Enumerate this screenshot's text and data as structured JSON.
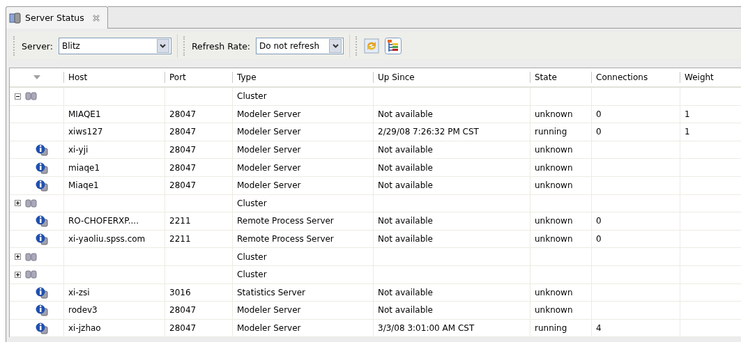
{
  "tab": {
    "title": "Server Status"
  },
  "toolbar": {
    "server_label": "Server:",
    "server_value": "Blitz",
    "refresh_label": "Refresh Rate:",
    "refresh_value": "Do not refresh"
  },
  "table": {
    "columns": [
      "Host",
      "Port",
      "Type",
      "Up Since",
      "State",
      "Connections",
      "Weight"
    ],
    "rows": [
      {
        "kind": "cluster",
        "expanded": true,
        "cells": [
          "",
          "",
          "Cluster",
          "",
          "",
          "",
          ""
        ],
        "children": [
          {
            "kind": "server",
            "info": false,
            "cells": [
              "MIAQE1",
              "28047",
              "Modeler Server",
              "Not available",
              "unknown",
              "0",
              "1"
            ]
          },
          {
            "kind": "server",
            "info": false,
            "cells": [
              "xiws127",
              "28047",
              "Modeler Server",
              "2/29/08 7:26:32 PM CST",
              "running",
              "0",
              "1"
            ]
          },
          {
            "kind": "server",
            "info": true,
            "cells": [
              "xi-yji",
              "28047",
              "Modeler Server",
              "Not available",
              "unknown",
              "",
              ""
            ]
          },
          {
            "kind": "server",
            "info": true,
            "cells": [
              "miaqe1",
              "28047",
              "Modeler Server",
              "Not available",
              "unknown",
              "",
              ""
            ]
          },
          {
            "kind": "server",
            "info": true,
            "cells": [
              "Miaqe1",
              "28047",
              "Modeler Server",
              "Not available",
              "unknown",
              "",
              ""
            ]
          }
        ]
      },
      {
        "kind": "cluster",
        "expanded": false,
        "cells": [
          "",
          "",
          "Cluster",
          "",
          "",
          "",
          ""
        ]
      },
      {
        "kind": "server",
        "info": true,
        "cells": [
          "RO-CHOFERXP....",
          "2211",
          "Remote Process Server",
          "Not available",
          "unknown",
          "0",
          ""
        ]
      },
      {
        "kind": "server",
        "info": true,
        "cells": [
          "xi-yaoliu.spss.com",
          "2211",
          "Remote Process Server",
          "Not available",
          "unknown",
          "0",
          ""
        ]
      },
      {
        "kind": "cluster",
        "expanded": false,
        "cells": [
          "",
          "",
          "Cluster",
          "",
          "",
          "",
          ""
        ]
      },
      {
        "kind": "cluster",
        "expanded": false,
        "cells": [
          "",
          "",
          "Cluster",
          "",
          "",
          "",
          ""
        ]
      },
      {
        "kind": "server",
        "info": true,
        "cells": [
          "xi-zsi",
          "3016",
          "Statistics Server",
          "Not available",
          "unknown",
          "",
          ""
        ]
      },
      {
        "kind": "server",
        "info": true,
        "cells": [
          "rodev3",
          "28047",
          "Modeler Server",
          "Not available",
          "unknown",
          "",
          ""
        ]
      },
      {
        "kind": "server",
        "info": true,
        "cells": [
          "xi-jzhao",
          "28047",
          "Modeler Server",
          "3/3/08 3:01:00 AM CST",
          "running",
          "4",
          ""
        ]
      }
    ]
  }
}
